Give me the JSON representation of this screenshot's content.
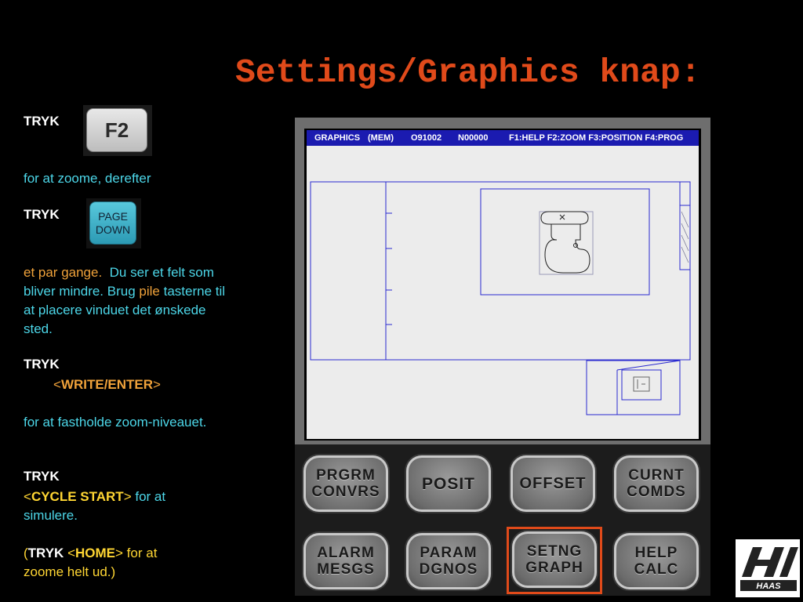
{
  "title": "Settings/Graphics knap:",
  "instructions": {
    "tryk1": "TRYK",
    "f2_key": "F2",
    "zoom_text": "for at zoome, derefter",
    "tryk2": "TRYK",
    "page_down_line1": "PAGE",
    "page_down_line2": "DOWN",
    "para1_a": "et par gange.",
    "para1_b": "Du ser et felt som bliver mindre.  Brug",
    "para1_c": "pile",
    "para1_d": "tasterne til at placere vinduet det ønskede sted.",
    "tryk3": "TRYK",
    "write_enter": "WRITE/ENTER",
    "hold_text": "for at fastholde zoom-niveauet.",
    "tryk4": "TRYK",
    "cycle_start": "CYCLE START",
    "simulate_text_a": "for at",
    "simulate_text_b": "simulere.",
    "tryk5": "TRYK",
    "home": "HOME",
    "home_text_a": "for at",
    "home_text_b": "zoome helt ud.)"
  },
  "screen": {
    "mode": "GRAPHICS",
    "mem": "(MEM)",
    "program": "O91002",
    "block": "N00000",
    "help": "F1:HELP F2:ZOOM F3:POSITION F4:PROG"
  },
  "keys": {
    "k1a": "PRGRM",
    "k1b": "CONVRS",
    "k2a": "POSIT",
    "k3a": "OFFSET",
    "k4a": "CURNT",
    "k4b": "COMDS",
    "k5a": "ALARM",
    "k5b": "MESGS",
    "k6a": "PARAM",
    "k6b": "DGNOS",
    "k7a": "SETNG",
    "k7b": "GRAPH",
    "k8a": "HELP",
    "k8b": "CALC"
  },
  "logo_text": "HAAS",
  "colors": {
    "title": "#e04a1a",
    "cyan": "#4cd6e8",
    "orange": "#f0a23a",
    "yellow": "#ffd633",
    "screen_bar": "#1b1bb0",
    "selection": "#e04a1a"
  }
}
